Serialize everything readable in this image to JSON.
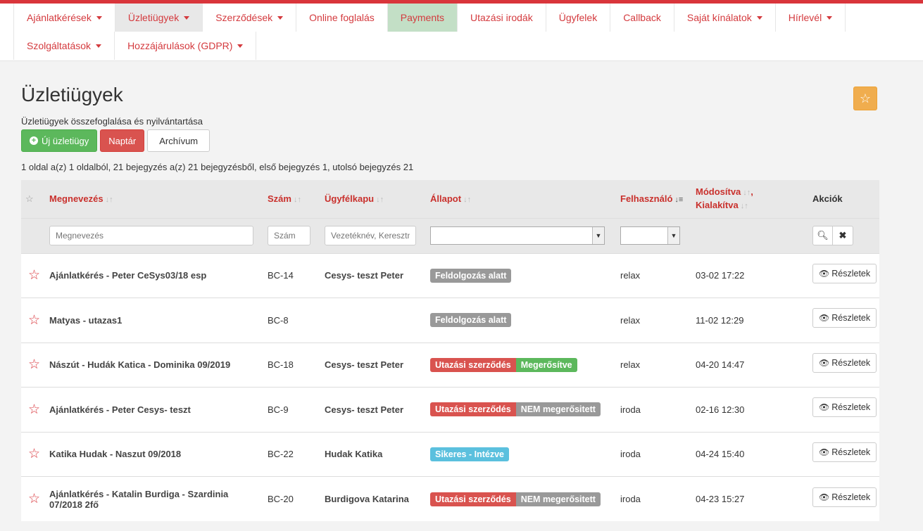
{
  "nav": {
    "row1": [
      {
        "label": "Ajánlatkérések",
        "caret": true
      },
      {
        "label": "Üzletiügyek",
        "caret": true,
        "active": true
      },
      {
        "label": "Szerződések",
        "caret": true
      },
      {
        "label": "Online foglalás",
        "caret": false
      },
      {
        "label": "Payments",
        "caret": false,
        "highlight": true
      },
      {
        "label": "Utazási irodák",
        "caret": false
      },
      {
        "label": "Ügyfelek",
        "caret": false
      },
      {
        "label": "Callback",
        "caret": false
      },
      {
        "label": "Saját kínálatok",
        "caret": true
      },
      {
        "label": "Hírlevél",
        "caret": true
      }
    ],
    "row2": [
      {
        "label": "Szolgáltatások",
        "caret": true
      },
      {
        "label": "Hozzájárulások (GDPR)",
        "caret": true
      }
    ]
  },
  "page": {
    "title": "Üzletiügyek",
    "subtitle": "Üzletiügyek összefoglalása és nyilvántartása",
    "new_button": "Új üzletiügy",
    "calendar_button": "Naptár",
    "archive_button": "Archívum",
    "paging": "1 oldal a(z) 1 oldalból, 21 bejegyzés a(z) 21 bejegyzésből, első bejegyzés 1, utolsó bejegyzés 21",
    "favorite_icon": "star-outline-icon"
  },
  "table": {
    "headers": {
      "star": "☆",
      "name": "Megnevezés",
      "number": "Szám",
      "client": "Ügyfélkapu",
      "status": "Állapot",
      "user": "Felhasználó",
      "modified": "Módosítva",
      "created": "Kialakítva",
      "actions": "Akciók"
    },
    "filters": {
      "name_placeholder": "Megnevezés",
      "number_placeholder": "Szám",
      "client_placeholder": "Vezetéknév, Keresztn"
    },
    "details_label": "Részletek",
    "rows": [
      {
        "name": "Ajánlatkérés - Peter CeSys03/18 esp",
        "number": "BC-14",
        "client": "Cesys- teszt Peter",
        "labels": [
          {
            "text": "Feldolgozás alatt",
            "color": "gray"
          }
        ],
        "user": "relax",
        "date": "03-02 17:22"
      },
      {
        "name": "Matyas - utazas1",
        "number": "BC-8",
        "client": "",
        "labels": [
          {
            "text": "Feldolgozás alatt",
            "color": "gray"
          }
        ],
        "user": "relax",
        "date": "11-02 12:29"
      },
      {
        "name": "Nászút - Hudák Katica - Dominika 09/2019",
        "number": "BC-18",
        "client": "Cesys- teszt Peter",
        "labels": [
          {
            "text": "Utazási szerződés",
            "color": "red"
          },
          {
            "text": "Megerősítve",
            "color": "green"
          }
        ],
        "user": "relax",
        "date": "04-20 14:47"
      },
      {
        "name": "Ajánlatkérés - Peter Cesys- teszt",
        "number": "BC-9",
        "client": "Cesys- teszt Peter",
        "labels": [
          {
            "text": "Utazási szerződés",
            "color": "red"
          },
          {
            "text": "NEM megerősitett",
            "color": "gray"
          }
        ],
        "user": "iroda",
        "date": "02-16 12:30"
      },
      {
        "name": "Katika Hudak - Naszut 09/2018",
        "number": "BC-22",
        "client": "Hudak Katika",
        "labels": [
          {
            "text": "Sikeres - Intézve",
            "color": "blue"
          }
        ],
        "user": "iroda",
        "date": "04-24 15:40"
      },
      {
        "name": "Ajánlatkérés - Katalin Burdiga - Szardinia 07/2018 2fő",
        "number": "BC-20",
        "client": "Burdigova Katarina",
        "labels": [
          {
            "text": "Utazási szerződés",
            "color": "red"
          },
          {
            "text": "NEM megerősitett",
            "color": "gray"
          }
        ],
        "user": "iroda",
        "date": "04-23 15:27"
      }
    ]
  },
  "colors": {
    "accent": "#d43a3e",
    "success": "#5cb85c",
    "danger": "#d9534f",
    "warning": "#f0ad4e",
    "info": "#5bc0de",
    "muted": "#999999"
  }
}
